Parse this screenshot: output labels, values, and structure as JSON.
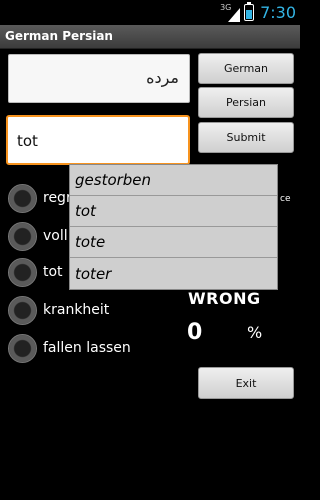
{
  "status_bar": {
    "network": "3G",
    "time": "7:30",
    "battery_level": 0.6,
    "accent_color": "#33b5e5"
  },
  "app": {
    "title": "German Persian"
  },
  "question": {
    "persian_text": "مرده"
  },
  "answer_input": {
    "value": "tot",
    "focus_color": "#f7931e"
  },
  "buttons": {
    "german": "German",
    "persian": "Persian",
    "submit": "Submit",
    "exit": "Exit"
  },
  "choices": [
    {
      "label": "regr"
    },
    {
      "label": "voll"
    },
    {
      "label": "tot"
    },
    {
      "label": "krankheit"
    },
    {
      "label": "fallen lassen"
    }
  ],
  "autocomplete": [
    "gestorben",
    "tot",
    "tote",
    "toter"
  ],
  "partial_text": "ce",
  "result": {
    "status": "WRONG",
    "score": "0",
    "percent_sign": "%"
  }
}
